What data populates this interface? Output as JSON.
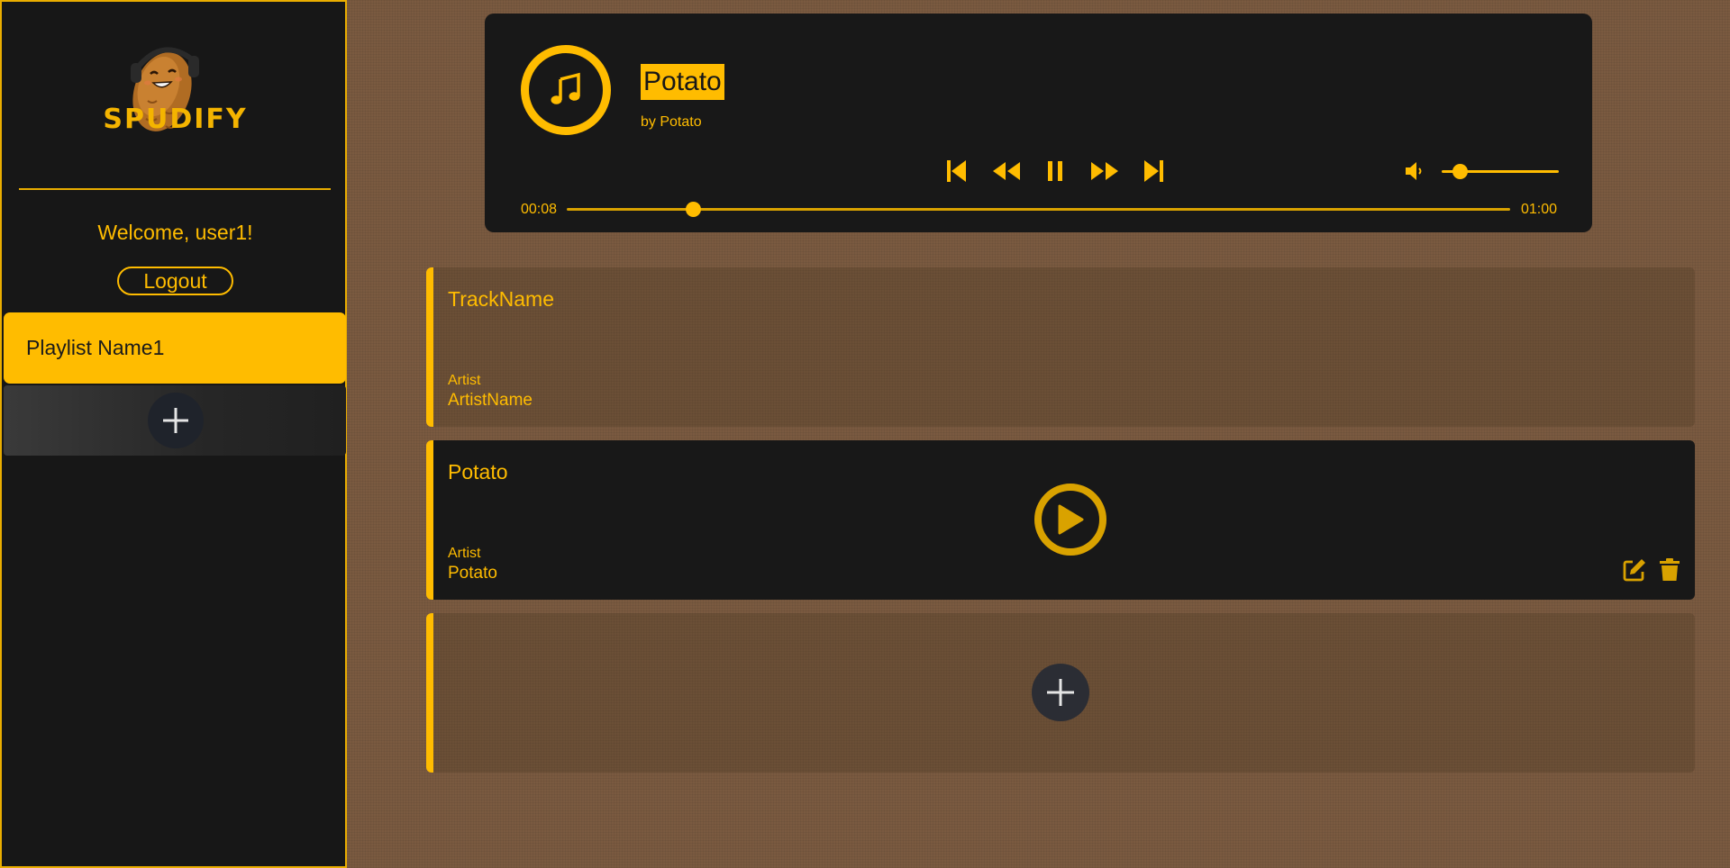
{
  "brand": {
    "name": "SPUDIFY"
  },
  "sidebar": {
    "welcome": "Welcome, user1!",
    "logout_label": "Logout",
    "playlists": [
      {
        "label": "Playlist Name1"
      }
    ],
    "add_playlist_icon": "plus-icon"
  },
  "player": {
    "title": "Potato",
    "by_line": "by Potato",
    "time_current": "00:08",
    "time_total": "01:00",
    "progress_fraction": 0.1333,
    "volume_fraction": 0.15,
    "state": "playing",
    "icons": [
      "music-note-icon",
      "skip-previous-icon",
      "rewind-icon",
      "pause-icon",
      "fast-forward-icon",
      "skip-next-icon",
      "volume-icon"
    ]
  },
  "tracks": [
    {
      "name": "TrackName",
      "artist_label": "Artist",
      "artist": "ArtistName"
    },
    {
      "name": "Potato",
      "artist_label": "Artist",
      "artist": "Potato"
    }
  ],
  "colors": {
    "accent": "#ffbc00",
    "panel": "#181818",
    "background": "#7a5a40"
  }
}
